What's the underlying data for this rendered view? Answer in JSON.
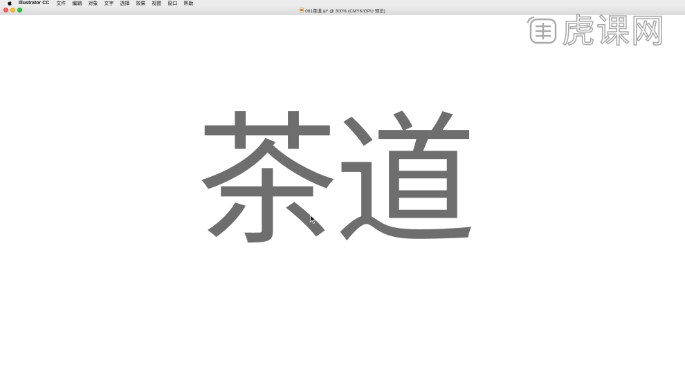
{
  "menubar": {
    "apple_icon": "apple-logo-icon",
    "app_name": "Illustrator CC",
    "items": [
      {
        "label": "文件"
      },
      {
        "label": "编辑"
      },
      {
        "label": "对象"
      },
      {
        "label": "文字"
      },
      {
        "label": "选择"
      },
      {
        "label": "效果"
      },
      {
        "label": "视图"
      },
      {
        "label": "窗口"
      },
      {
        "label": "帮助"
      }
    ]
  },
  "window": {
    "title": "061茶道.ai* @ 300% (CMYK/GPU 预览)",
    "doc_icon": "illustrator-document-icon",
    "controls": {
      "close_color": "#fc5f57",
      "minimize_color": "#fdbc2e",
      "zoom_color": "#29c840"
    }
  },
  "canvas": {
    "artwork_text": "茶道",
    "artwork_color": "#6e6e6e",
    "background": "#ffffff"
  },
  "watermark": {
    "logo_icon": "huke-logo-icon",
    "text": "虎课网"
  }
}
